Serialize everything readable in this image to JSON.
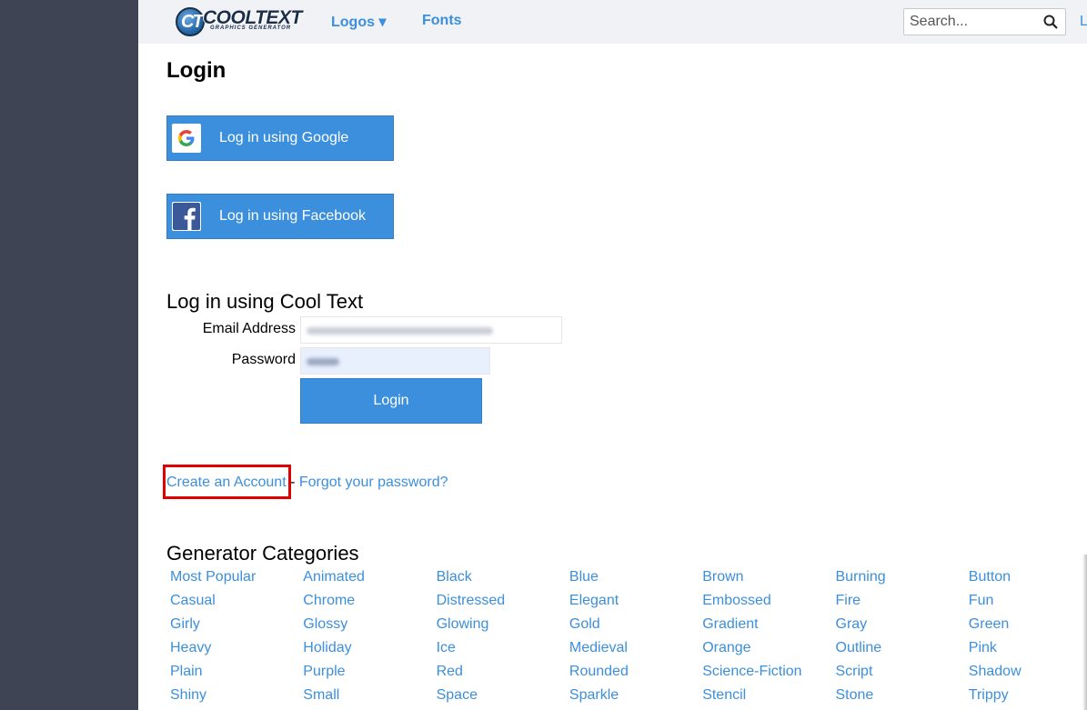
{
  "header": {
    "logo_text": "COOLTEXT",
    "logo_tagline": "GRAPHICS GENERATOR",
    "logo_badge": "CT",
    "nav": [
      {
        "label": "Logos ▾"
      },
      {
        "label": "Fonts"
      }
    ],
    "search": {
      "placeholder": "Search...",
      "value": ""
    },
    "edge_text": "L"
  },
  "page": {
    "title": "Login",
    "google_button": "Log in using Google",
    "facebook_button": "Log in using Facebook",
    "cooltext_heading": "Log in using Cool Text",
    "email_label": "Email Address",
    "password_label": "Password",
    "login_button": "Login",
    "create_account": "Create an Account",
    "separator": " - ",
    "forgot_password": "Forgot your password?"
  },
  "categories": {
    "heading": "Generator Categories",
    "columns": [
      [
        "Most Popular",
        "Casual",
        "Girly",
        "Heavy",
        "Plain",
        "Shiny"
      ],
      [
        "Animated",
        "Chrome",
        "Glossy",
        "Holiday",
        "Purple",
        "Small"
      ],
      [
        "Black",
        "Distressed",
        "Glowing",
        "Ice",
        "Red",
        "Space"
      ],
      [
        "Blue",
        "Elegant",
        "Gold",
        "Medieval",
        "Rounded",
        "Sparkle"
      ],
      [
        "Brown",
        "Embossed",
        "Gradient",
        "Orange",
        "Science-Fiction",
        "Stencil"
      ],
      [
        "Burning",
        "Fire",
        "Gray",
        "Outline",
        "Script",
        "Stone"
      ],
      [
        "Button",
        "Fun",
        "Green",
        "Pink",
        "Shadow",
        "Trippy"
      ]
    ]
  },
  "colors": {
    "accent": "#3b8fdd",
    "sidebar": "#3e4453",
    "highlight": "#e00000"
  }
}
